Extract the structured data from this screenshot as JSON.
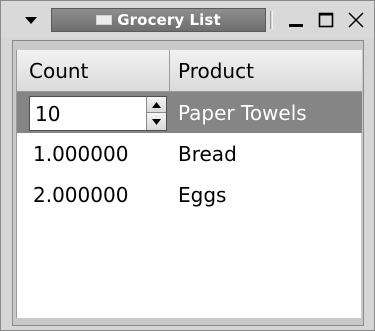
{
  "window": {
    "title": "Grocery List",
    "menu_icon": "triangle-down-icon",
    "window_icon": "window-icon",
    "controls": [
      "minimize-icon",
      "maximize-icon",
      "close-icon"
    ]
  },
  "table": {
    "headers": {
      "count": "Count",
      "product": "Product"
    },
    "editor": {
      "value": "10"
    },
    "rows": [
      {
        "count": "",
        "product": "Paper Towels",
        "selected": true
      },
      {
        "count": "1.000000",
        "product": "Bread",
        "selected": false
      },
      {
        "count": "2.000000",
        "product": "Eggs",
        "selected": false
      }
    ]
  },
  "colors": {
    "title_bar_active": "#7e7e7e",
    "selection": "#858585"
  }
}
